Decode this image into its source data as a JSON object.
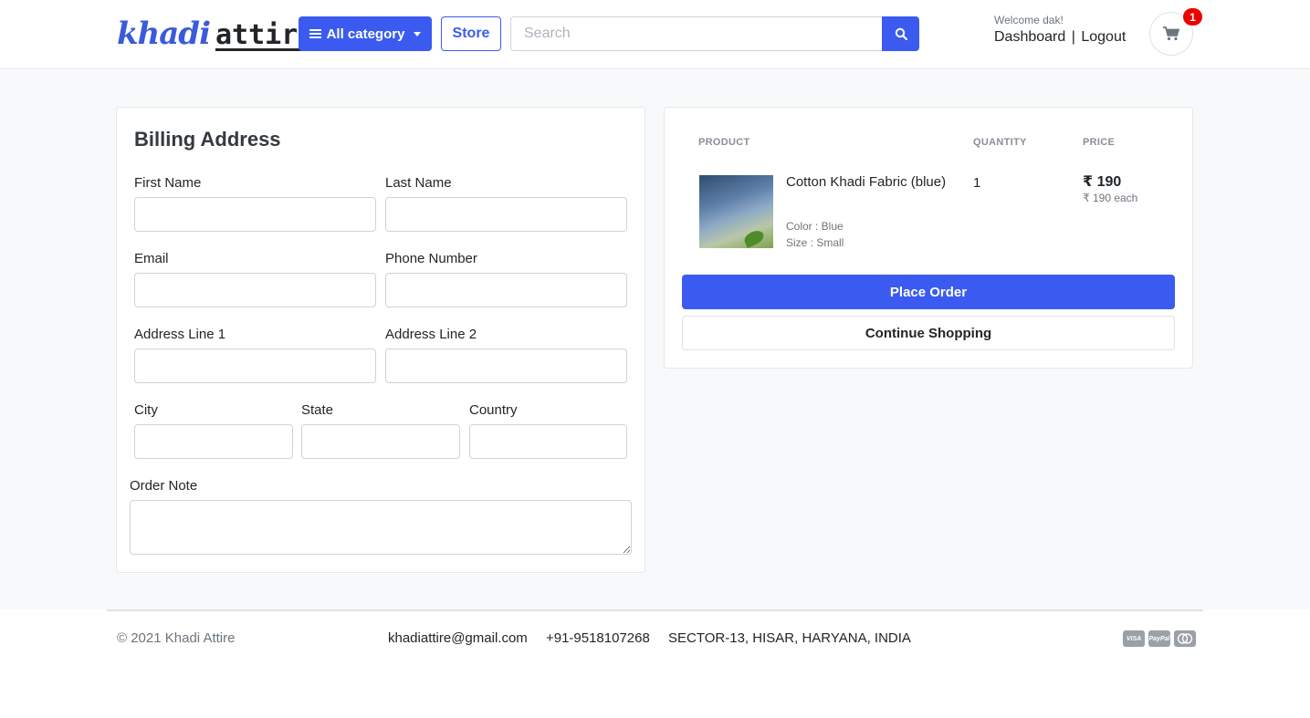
{
  "header": {
    "logo": {
      "part1": "khadi",
      "part2": "attire"
    },
    "category_button": "All category",
    "store_button": "Store",
    "search_placeholder": "Search",
    "welcome": "Welcome dak!",
    "dashboard_link": "Dashboard",
    "separator": "|",
    "logout_link": "Logout",
    "cart_count": "1"
  },
  "billing": {
    "title": "Billing Address",
    "fields": {
      "first_name": "First Name",
      "last_name": "Last Name",
      "email": "Email",
      "phone": "Phone Number",
      "address1": "Address Line 1",
      "address2": "Address Line 2",
      "city": "City",
      "state": "State",
      "country": "Country",
      "order_note": "Order Note"
    }
  },
  "summary": {
    "columns": {
      "product": "PRODUCT",
      "quantity": "QUANTITY",
      "price": "PRICE"
    },
    "item": {
      "name": "Cotton Khadi Fabric (blue)",
      "color": "Color : Blue",
      "size": "Size : Small",
      "quantity": "1",
      "price": "₹ 190",
      "each": "₹ 190 each"
    },
    "place_order": "Place Order",
    "continue_shopping": "Continue Shopping"
  },
  "footer": {
    "copyright": "© 2021 Khadi Attire",
    "email": "khadiattire@gmail.com",
    "phone": "+91-9518107268",
    "address": "SECTOR-13, HISAR, HARYANA, INDIA",
    "payment_icons": [
      "visa-icon",
      "paypal-icon",
      "mastercard-icon"
    ]
  },
  "colors": {
    "accent": "#3b5bf0",
    "badge": "#ee0000",
    "background": "#f8f9fa"
  }
}
